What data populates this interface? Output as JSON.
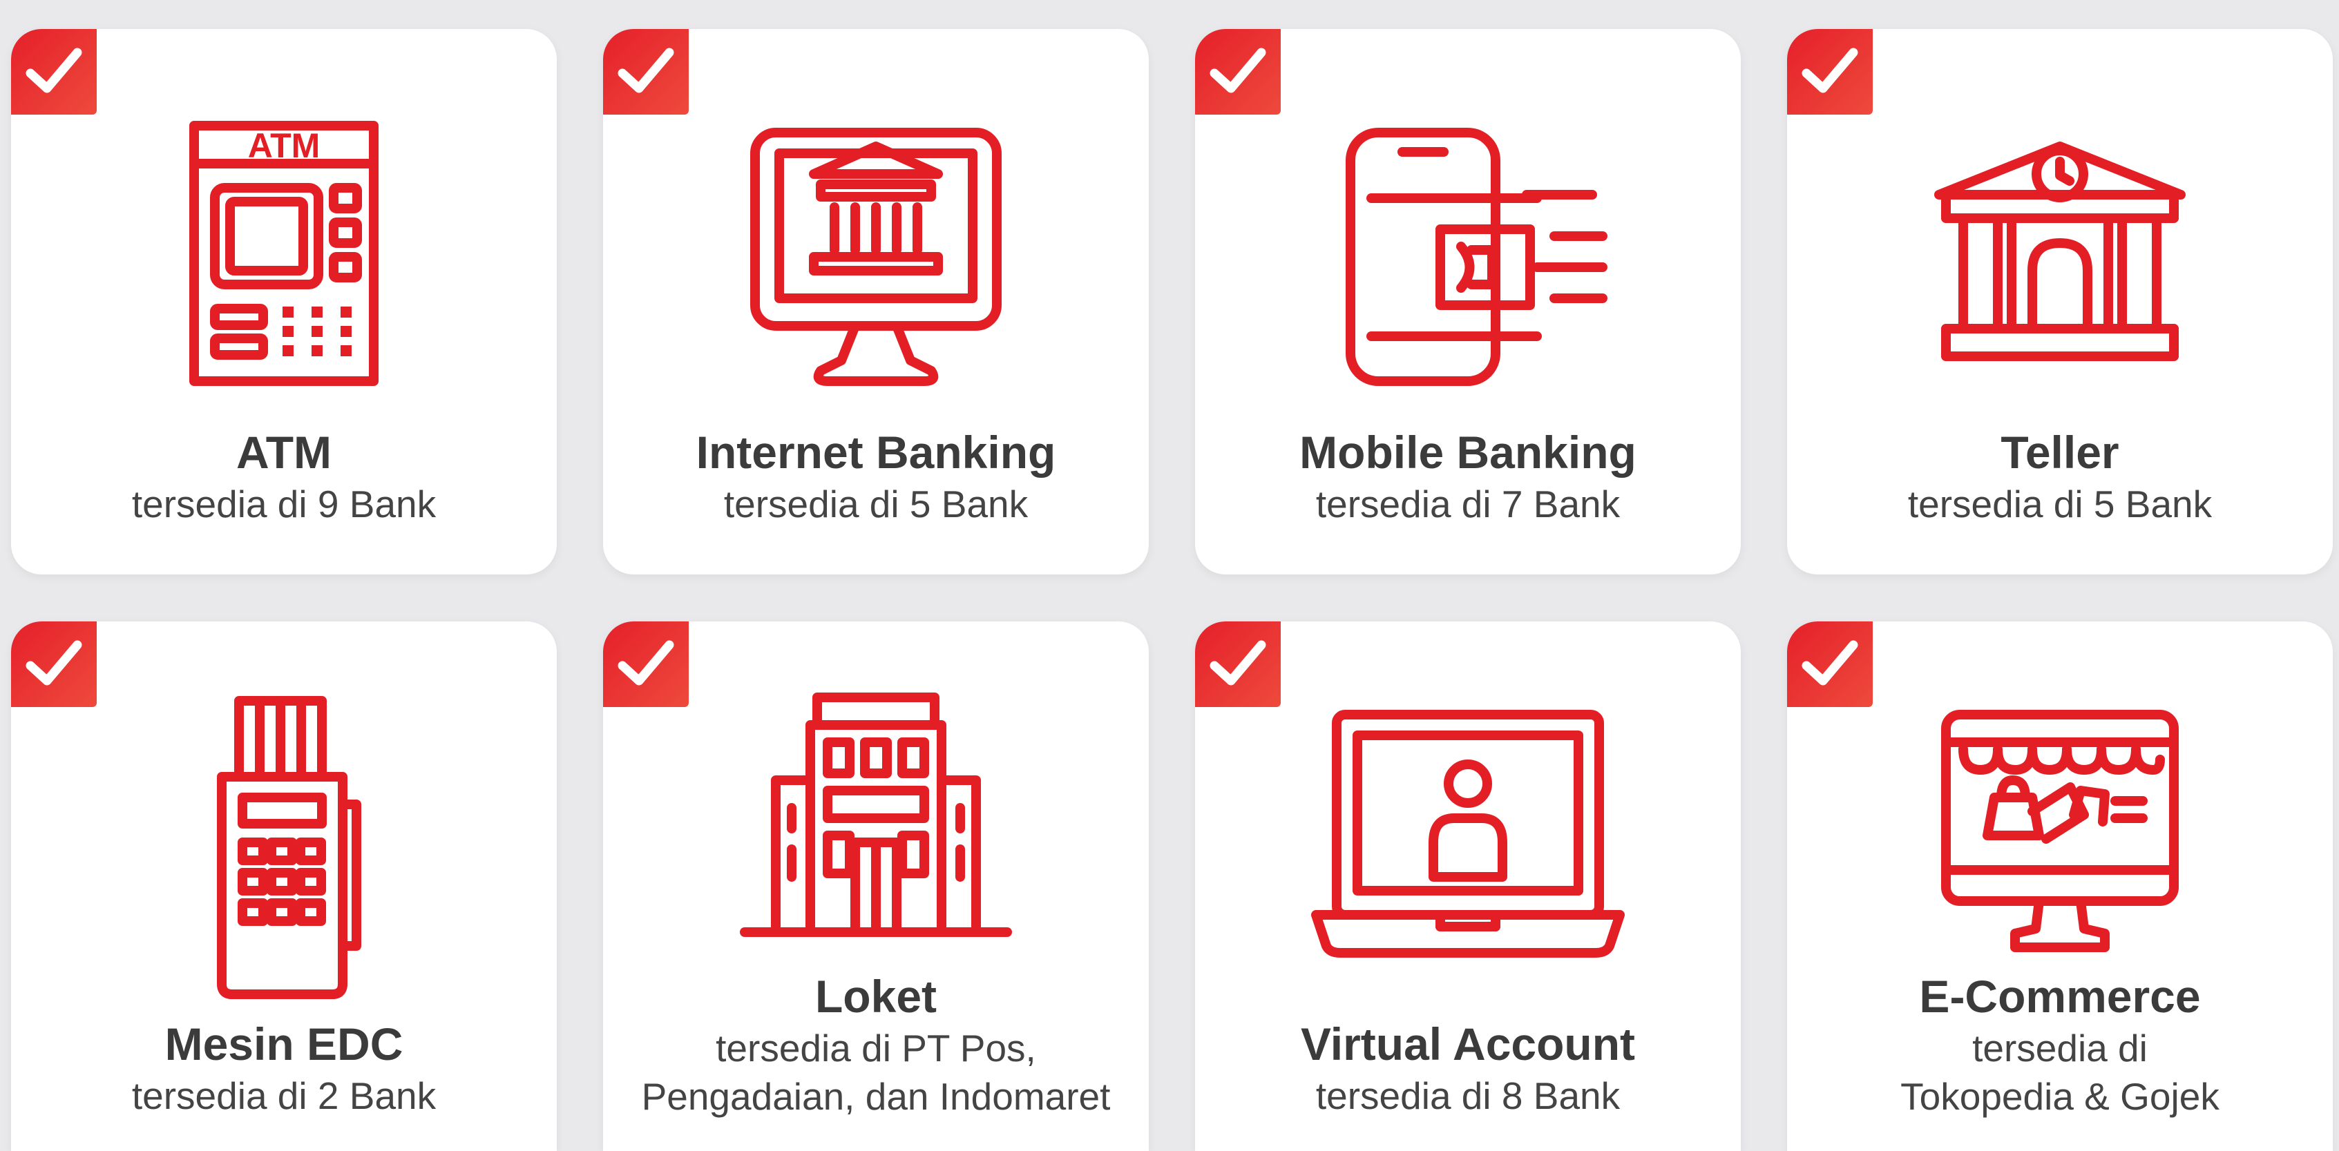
{
  "cards": [
    {
      "title": "ATM",
      "lines": [
        "tersedia di 9 Bank"
      ],
      "icon": "atm-machine-icon"
    },
    {
      "title": "Internet Banking",
      "lines": [
        "tersedia di 5 Bank"
      ],
      "icon": "monitor-bank-icon"
    },
    {
      "title": "Mobile Banking",
      "lines": [
        "tersedia di 7 Bank"
      ],
      "icon": "mobile-payment-icon"
    },
    {
      "title": "Teller",
      "lines": [
        "tersedia di 5 Bank"
      ],
      "icon": "bank-building-clock-icon"
    },
    {
      "title": "Mesin EDC",
      "lines": [
        "tersedia di 2 Bank"
      ],
      "icon": "edc-card-terminal-icon"
    },
    {
      "title": "Loket",
      "lines": [
        "tersedia di PT Pos,",
        "Pengadaian, dan Indomaret"
      ],
      "icon": "office-building-icon"
    },
    {
      "title": "Virtual Account",
      "lines": [
        "tersedia di 8 Bank"
      ],
      "icon": "laptop-user-icon"
    },
    {
      "title": "E-Commerce",
      "lines": [
        "tersedia di",
        "Tokopedia & Gojek"
      ],
      "icon": "online-shop-monitor-icon"
    }
  ],
  "colors": {
    "accent": "#e31e25",
    "check_bg": "#ea3a36",
    "background": "#e9e9ec",
    "card": "#ffffff"
  }
}
